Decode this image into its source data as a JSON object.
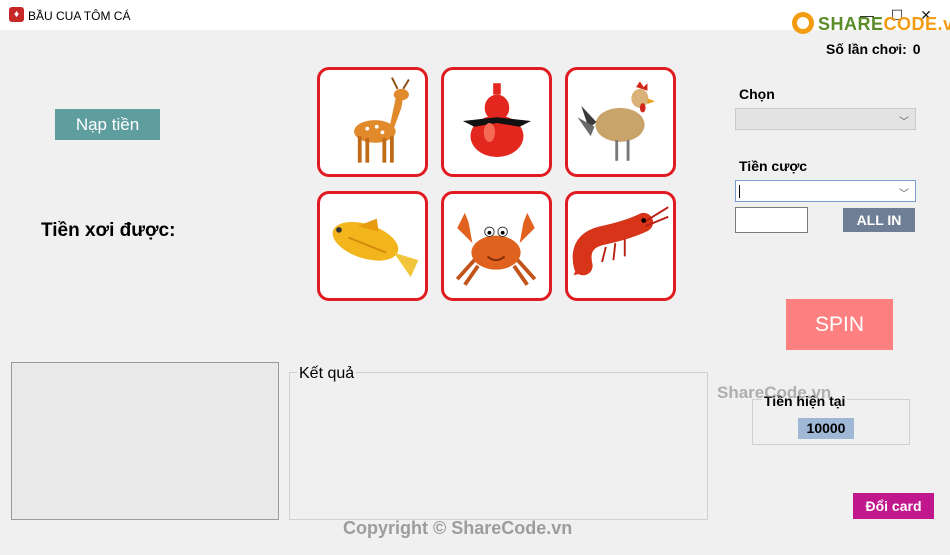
{
  "window": {
    "title": "BẦU CUA TÔM CÁ",
    "minimize": "—",
    "maximize": "☐",
    "close": "✕"
  },
  "watermark": {
    "logo_share": "SHARE",
    "logo_code": "CODE.vn",
    "middle": "ShareCode.vn",
    "bottom": "Copyright © ShareCode.vn"
  },
  "stats": {
    "plays_label": "Số lần chơi:",
    "plays_value": "0"
  },
  "left": {
    "deposit_button": "Nạp tiền",
    "won_label": "Tiền xơi được:"
  },
  "tiles": [
    {
      "name": "deer",
      "icon": "deer-icon"
    },
    {
      "name": "gourd",
      "icon": "gourd-icon"
    },
    {
      "name": "rooster",
      "icon": "rooster-icon"
    },
    {
      "name": "fish",
      "icon": "fish-icon"
    },
    {
      "name": "crab",
      "icon": "crab-icon"
    },
    {
      "name": "shrimp",
      "icon": "shrimp-icon"
    }
  ],
  "right": {
    "choose_label": "Chọn",
    "choose_value": "",
    "bet_label": "Tiền cược",
    "bet_value": "",
    "amount_value": "",
    "allin_button": "ALL IN",
    "spin_button": "SPIN"
  },
  "result": {
    "title": "Kết quả"
  },
  "balance": {
    "label": "Tiền hiện tại",
    "value": "10000"
  },
  "footer": {
    "change_card_button": "Đổi card"
  },
  "colors": {
    "tile_border": "#e11b22",
    "deposit": "#5f9e9e",
    "allin": "#6e7f95",
    "spin": "#ff8080",
    "change_card": "#c0188c",
    "balance_bg": "#9fb8d6"
  }
}
